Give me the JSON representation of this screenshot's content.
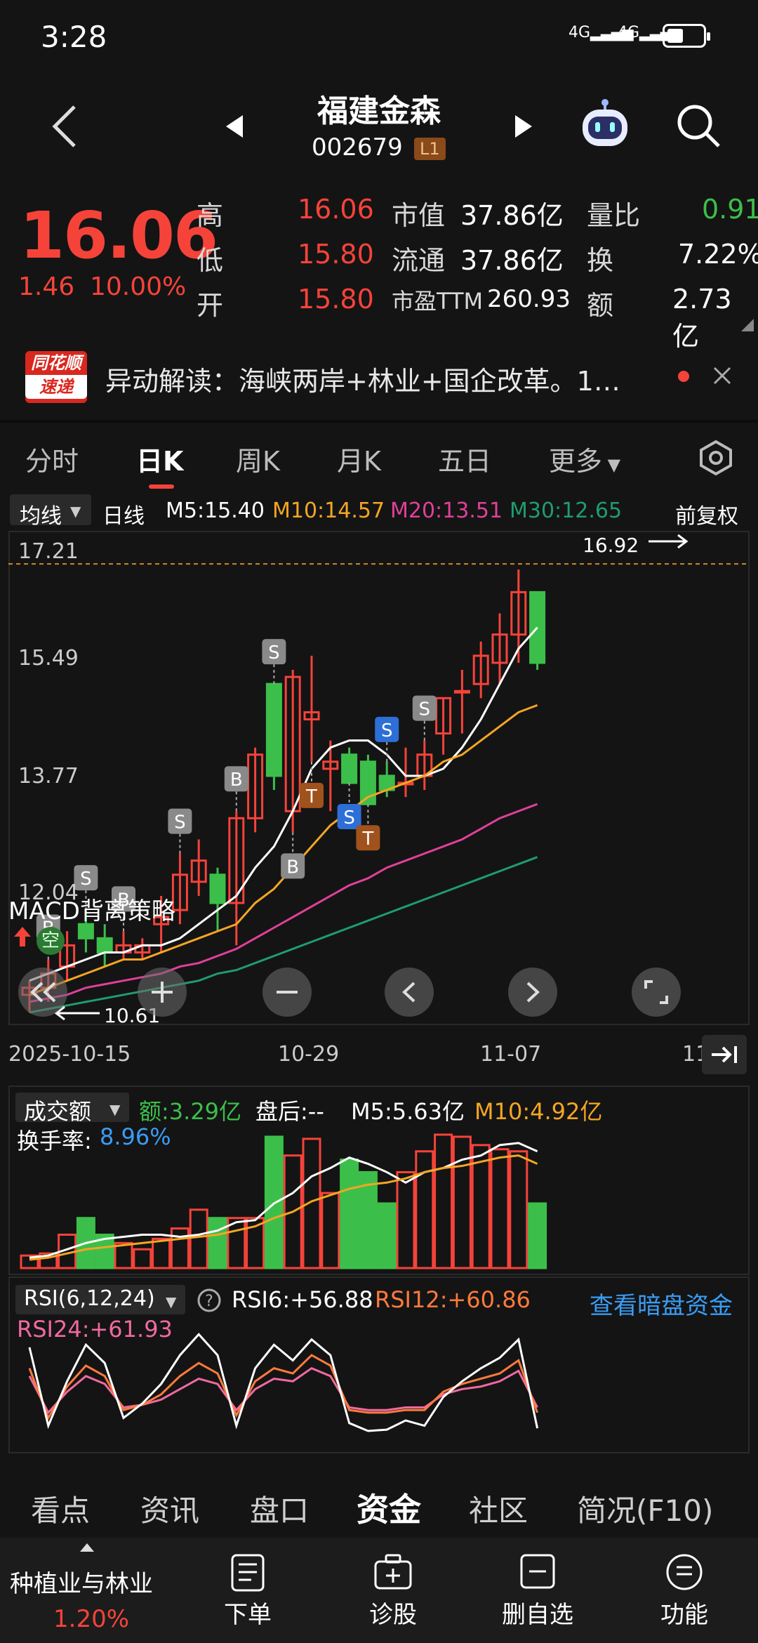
{
  "status": {
    "time": "3:28",
    "sig1": "4G",
    "sig2": "4G"
  },
  "header": {
    "title": "福建金森",
    "code": "002679",
    "level": "L1"
  },
  "quote": {
    "price": "16.06",
    "change": "1.46",
    "change_pct": "10.00%",
    "high_label": "高",
    "high": "16.06",
    "low_label": "低",
    "low": "15.80",
    "open_label": "开",
    "open": "15.80",
    "mcap_label": "市值",
    "mcap": "37.86亿",
    "float_label": "流通",
    "float": "37.86亿",
    "pe_label": "市盈TTM",
    "pe": "260.93",
    "vr_label": "量比",
    "vr": "0.91",
    "turn_label": "换",
    "turn": "7.22%",
    "amt_label": "额",
    "amt": "2.73亿"
  },
  "news": {
    "brand_top": "同花顺",
    "brand_bottom": "速递",
    "text": "异动解读：海峡两岸+林业+国企改革。1…"
  },
  "tabs": [
    "分时",
    "日K",
    "周K",
    "月K",
    "五日",
    "更多"
  ],
  "ma": {
    "selector": "均线",
    "period": "日线",
    "m5": "M5:15.40",
    "m10": "M10:14.57",
    "m20": "M20:13.51",
    "m30": "M30:12.65",
    "adjust": "前复权"
  },
  "kline": {
    "y_labels": [
      "17.21",
      "15.49",
      "13.77",
      "12.04"
    ],
    "max_label": "16.92",
    "min_label": "10.61",
    "strategy": "MACD背离策略",
    "empty_tag": "空",
    "x_labels": [
      "2025-10-15",
      "10-29",
      "11-07",
      "11"
    ]
  },
  "volume": {
    "selector": "成交额",
    "amt": "额:3.29亿",
    "after": "盘后:--",
    "m5": "M5:5.63亿",
    "m10": "M10:4.92亿",
    "turn_label": "换手率:",
    "turn_value": "8.96%"
  },
  "rsi": {
    "selector": "RSI(6,12,24)",
    "rsi6": "RSI6:+56.88",
    "rsi12": "RSI12:+60.86",
    "rsi24": "RSI24:+61.93",
    "link": "查看暗盘资金"
  },
  "bottom_tabs": [
    "看点",
    "资讯",
    "盘口",
    "资金",
    "社区",
    "简况(F10)"
  ],
  "nav": {
    "sector": "种植业与林业",
    "sector_pct": "1.20%",
    "items": [
      "下单",
      "诊股",
      "删自选",
      "功能"
    ]
  },
  "colors": {
    "up": "#f5433a",
    "down": "#3cbf4a",
    "ma5": "#ffffff",
    "ma10": "#f5a623",
    "ma20": "#e0409a",
    "ma30": "#1f9c6e"
  },
  "chart_data": {
    "type": "candlestick",
    "ylim": [
      10.61,
      17.21
    ],
    "candles": [
      {
        "o": 10.9,
        "h": 11.1,
        "l": 10.65,
        "c": 11.0
      },
      {
        "o": 11.0,
        "h": 11.4,
        "l": 10.8,
        "c": 11.2
      },
      {
        "o": 11.3,
        "h": 11.8,
        "l": 11.1,
        "c": 11.6
      },
      {
        "o": 11.9,
        "h": 12.1,
        "l": 11.5,
        "c": 11.7
      },
      {
        "o": 11.7,
        "h": 11.9,
        "l": 11.3,
        "c": 11.5
      },
      {
        "o": 11.5,
        "h": 11.8,
        "l": 11.4,
        "c": 11.6
      },
      {
        "o": 11.5,
        "h": 11.7,
        "l": 11.4,
        "c": 11.6
      },
      {
        "o": 11.9,
        "h": 12.3,
        "l": 11.5,
        "c": 12.0
      },
      {
        "o": 12.1,
        "h": 12.9,
        "l": 11.9,
        "c": 12.6
      },
      {
        "o": 12.5,
        "h": 13.1,
        "l": 12.3,
        "c": 12.8
      },
      {
        "o": 12.6,
        "h": 12.7,
        "l": 11.8,
        "c": 12.2
      },
      {
        "o": 12.2,
        "h": 13.5,
        "l": 11.6,
        "c": 13.4
      },
      {
        "o": 13.4,
        "h": 14.4,
        "l": 13.2,
        "c": 14.3
      },
      {
        "o": 15.3,
        "h": 15.3,
        "l": 13.8,
        "c": 14.0
      },
      {
        "o": 13.5,
        "h": 15.5,
        "l": 13.2,
        "c": 15.4
      },
      {
        "o": 14.8,
        "h": 15.7,
        "l": 14.2,
        "c": 14.9
      },
      {
        "o": 14.1,
        "h": 14.5,
        "l": 13.5,
        "c": 14.2
      },
      {
        "o": 14.3,
        "h": 14.4,
        "l": 13.9,
        "c": 13.9
      },
      {
        "o": 14.2,
        "h": 14.3,
        "l": 13.6,
        "c": 13.6
      },
      {
        "o": 14.0,
        "h": 14.2,
        "l": 13.7,
        "c": 13.8
      },
      {
        "o": 13.9,
        "h": 14.4,
        "l": 13.7,
        "c": 13.9
      },
      {
        "o": 14.0,
        "h": 14.5,
        "l": 13.8,
        "c": 14.3
      },
      {
        "o": 14.6,
        "h": 15.1,
        "l": 14.3,
        "c": 15.1
      },
      {
        "o": 15.2,
        "h": 15.5,
        "l": 14.6,
        "c": 15.2
      },
      {
        "o": 15.3,
        "h": 15.9,
        "l": 15.1,
        "c": 15.7
      },
      {
        "o": 15.6,
        "h": 16.3,
        "l": 15.3,
        "c": 16.0
      },
      {
        "o": 16.0,
        "h": 16.92,
        "l": 15.6,
        "c": 16.6
      },
      {
        "o": 16.6,
        "h": 16.6,
        "l": 15.5,
        "c": 15.6
      }
    ],
    "ma5": [
      11.1,
      11.2,
      11.3,
      11.4,
      11.5,
      11.5,
      11.6,
      11.6,
      11.7,
      11.9,
      12.1,
      12.3,
      12.7,
      13.0,
      13.5,
      14.1,
      14.4,
      14.5,
      14.5,
      14.3,
      14.0,
      14.0,
      14.1,
      14.4,
      14.8,
      15.3,
      15.8,
      16.1
    ],
    "ma10": [
      10.9,
      11.0,
      11.1,
      11.2,
      11.3,
      11.4,
      11.4,
      11.5,
      11.6,
      11.7,
      11.8,
      11.9,
      12.2,
      12.4,
      12.7,
      13.0,
      13.3,
      13.5,
      13.7,
      13.8,
      13.9,
      14.0,
      14.2,
      14.3,
      14.5,
      14.7,
      14.9,
      15.0
    ],
    "ma20": [
      10.8,
      10.85,
      10.9,
      11.0,
      11.05,
      11.1,
      11.15,
      11.2,
      11.3,
      11.35,
      11.45,
      11.55,
      11.7,
      11.85,
      12.0,
      12.15,
      12.3,
      12.45,
      12.55,
      12.7,
      12.8,
      12.9,
      13.0,
      13.1,
      13.25,
      13.4,
      13.5,
      13.6
    ],
    "ma30": [
      10.65,
      10.7,
      10.75,
      10.8,
      10.85,
      10.9,
      10.95,
      11.0,
      11.05,
      11.1,
      11.2,
      11.25,
      11.35,
      11.45,
      11.55,
      11.65,
      11.75,
      11.85,
      11.95,
      12.05,
      12.15,
      12.25,
      12.35,
      12.45,
      12.55,
      12.65,
      12.75,
      12.85
    ],
    "signals": [
      {
        "i": 1,
        "label": "B",
        "pos": "above",
        "c": "gray"
      },
      {
        "i": 3,
        "label": "S",
        "pos": "above",
        "c": "gray"
      },
      {
        "i": 5,
        "label": "B",
        "pos": "above",
        "c": "gray"
      },
      {
        "i": 8,
        "label": "S",
        "pos": "above",
        "c": "gray"
      },
      {
        "i": 11,
        "label": "B",
        "pos": "above",
        "c": "gray"
      },
      {
        "i": 13,
        "label": "S",
        "pos": "above",
        "c": "gray"
      },
      {
        "i": 14,
        "label": "B",
        "pos": "below",
        "c": "gray"
      },
      {
        "i": 15,
        "label": "T",
        "pos": "below",
        "c": "brown"
      },
      {
        "i": 17,
        "label": "S",
        "pos": "below",
        "c": "blue"
      },
      {
        "i": 18,
        "label": "T",
        "pos": "below",
        "c": "brown"
      },
      {
        "i": 19,
        "label": "S",
        "pos": "above",
        "c": "blue"
      },
      {
        "i": 21,
        "label": "S",
        "pos": "above",
        "c": "gray"
      }
    ],
    "volume": [
      0.6,
      0.7,
      1.6,
      2.4,
      1.6,
      1.2,
      0.9,
      1.4,
      1.9,
      2.8,
      2.4,
      2.4,
      2.4,
      6.3,
      5.4,
      6.2,
      3.6,
      5.2,
      4.6,
      3.1,
      4.6,
      5.6,
      6.4,
      6.3,
      5.9,
      5.7,
      5.6,
      3.1
    ],
    "vol_ma5": [
      0.5,
      0.6,
      0.9,
      1.2,
      1.4,
      1.5,
      1.6,
      1.6,
      1.5,
      1.6,
      1.8,
      2.2,
      2.3,
      3.1,
      3.6,
      4.4,
      4.8,
      5.3,
      5.0,
      4.6,
      4.1,
      4.6,
      4.8,
      5.2,
      5.4,
      5.9,
      6.0,
      5.6
    ],
    "vol_ma10": [
      0.4,
      0.5,
      0.7,
      0.9,
      1.0,
      1.1,
      1.2,
      1.3,
      1.4,
      1.5,
      1.6,
      1.8,
      2.0,
      2.4,
      2.7,
      3.2,
      3.5,
      3.8,
      4.0,
      4.1,
      4.3,
      4.6,
      4.8,
      4.9,
      5.1,
      5.3,
      5.4,
      5.0
    ],
    "rsi6": [
      78,
      18,
      52,
      80,
      66,
      24,
      35,
      50,
      72,
      88,
      72,
      18,
      62,
      80,
      68,
      84,
      72,
      20,
      14,
      15,
      22,
      18,
      40,
      52,
      62,
      70,
      84,
      16
    ],
    "rsi12": [
      62,
      24,
      48,
      64,
      56,
      30,
      34,
      42,
      56,
      66,
      58,
      26,
      52,
      62,
      58,
      72,
      64,
      30,
      28,
      28,
      30,
      30,
      44,
      50,
      54,
      58,
      68,
      28
    ],
    "rsi24": [
      56,
      28,
      44,
      56,
      50,
      32,
      34,
      38,
      46,
      54,
      50,
      30,
      46,
      54,
      52,
      62,
      56,
      32,
      30,
      30,
      32,
      32,
      42,
      46,
      48,
      52,
      60,
      32
    ]
  }
}
